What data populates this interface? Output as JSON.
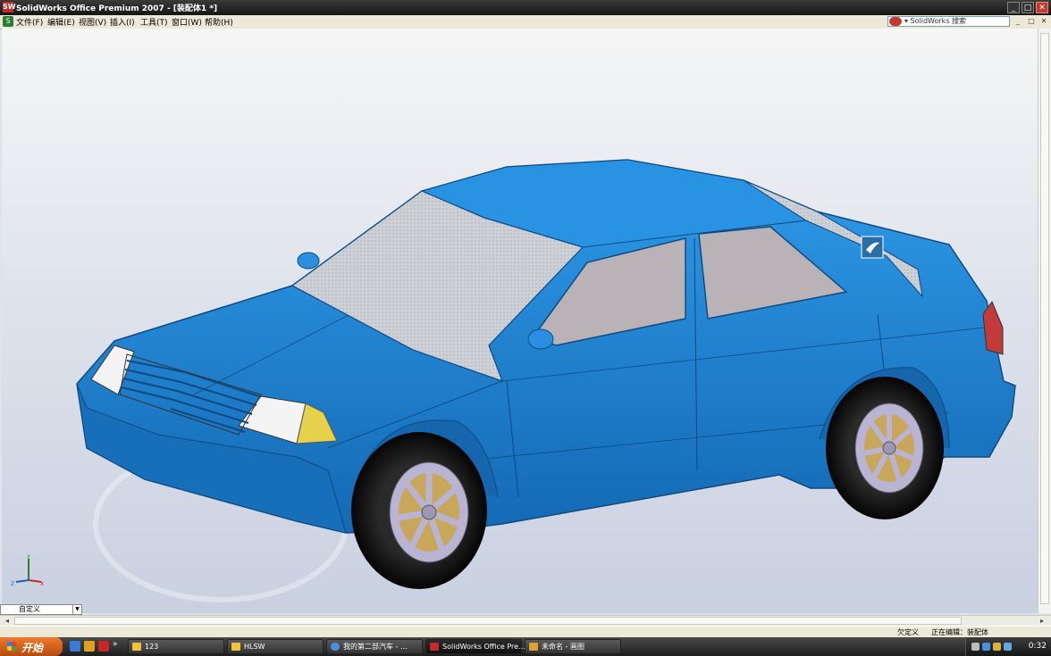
{
  "window": {
    "title": "SolidWorks Office Premium 2007 - [装配体1 *]",
    "app_icon": "SW",
    "buttons": [
      "_",
      "□",
      "✕"
    ]
  },
  "menu": {
    "items": [
      "文件(F)",
      "编辑(E)",
      "视图(V)",
      "插入(I)",
      "工具(T)",
      "窗口(W)",
      "帮助(H)"
    ],
    "search_placeholder": "▾ SolidWorks 搜索",
    "doc_buttons": [
      "_",
      "□",
      "✕"
    ]
  },
  "viewport": {
    "model": "sedan car assembly",
    "body_color": "#1f88d8",
    "glass_color": "#c9cdd6",
    "triad": {
      "x": "X",
      "y": "Y",
      "z": "Z"
    }
  },
  "bottom": {
    "config_label": "自定义",
    "status": {
      "state": "欠定义",
      "editing": "正在编辑：装配体"
    }
  },
  "taskbar": {
    "start_label": "开始",
    "tasks": [
      {
        "label": "123",
        "icon_color": "#f3c13a"
      },
      {
        "label": "HLSW",
        "icon_color": "#f3c13a"
      },
      {
        "label": "我的第二部汽车 - ...",
        "icon_color": "#4a90e2"
      },
      {
        "label": "SolidWorks Office Pre...",
        "icon_color": "#c62828"
      },
      {
        "label": "未命名 - 画图",
        "icon_color": "#e0a030"
      }
    ],
    "clock": "0:32"
  }
}
